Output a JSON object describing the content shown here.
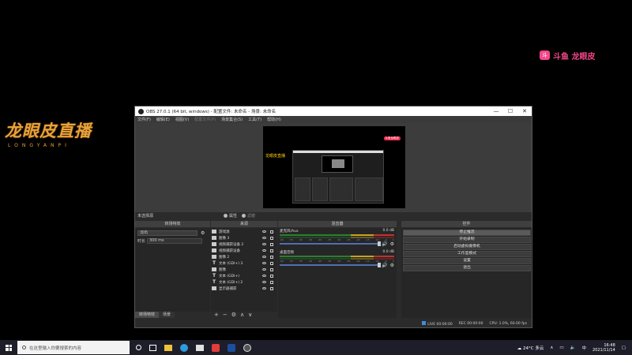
{
  "overlay": {
    "brand_cn": "龙眼皮直播",
    "brand_en": "LONGYANPI",
    "douyu_logo": "斗",
    "douyu_text": "斗鱼 龙眼皮"
  },
  "window": {
    "title": "OBS 27.0.1 (64 bit, windows) - 配置文件: 未命名 - 场景: 未命名",
    "controls": [
      "—",
      "☐",
      "✕"
    ]
  },
  "menu": {
    "items": [
      "文件(F)",
      "编辑(E)",
      "视图(V)",
      "配置文件(P)",
      "场景集合(S)",
      "工具(T)",
      "帮助(H)"
    ],
    "disabled_index": 3
  },
  "preview": {
    "overlay_text": "龙眼皮直播",
    "badge": "斗鱼龙眼皮"
  },
  "scene_bar": {
    "selection": "未选择源",
    "properties": "属性",
    "filters": "滤镜"
  },
  "docks": {
    "transitions": "转场特效",
    "sources": "来源",
    "mixer": "混音器",
    "controls": "控件"
  },
  "transitions": {
    "selected": "淡出",
    "duration_label": "时长",
    "duration_value": "300 ms"
  },
  "bottom_tabs": [
    "转场特效",
    "场景"
  ],
  "sources": [
    {
      "name": "游戏源",
      "icon": "game-icon"
    },
    {
      "name": "图像 3",
      "icon": "image-icon"
    },
    {
      "name": "视频捕获设备 2",
      "icon": "camera-icon"
    },
    {
      "name": "视频捕获设备",
      "icon": "camera-icon"
    },
    {
      "name": "图像 2",
      "icon": "image-icon"
    },
    {
      "name": "文本 (GDI+) 3",
      "icon": "text-icon"
    },
    {
      "name": "图像",
      "icon": "image-icon"
    },
    {
      "name": "文本 (GDI+)",
      "icon": "text-icon"
    },
    {
      "name": "文本 (GDI+) 2",
      "icon": "text-icon"
    },
    {
      "name": "显示器捕获",
      "icon": "monitor-icon"
    }
  ],
  "source_toolbar": [
    "+",
    "−",
    "⚙",
    "∧",
    "∨"
  ],
  "mixer": {
    "channels": [
      {
        "name": "麦克风/Aux",
        "db": "0.0 dB"
      },
      {
        "name": "桌面音频",
        "db": "0.0 dB"
      }
    ],
    "ticks": [
      "-60",
      "-55",
      "-50",
      "-45",
      "-40",
      "-35",
      "-30",
      "-25",
      "-20",
      "-15",
      "-10",
      "-5",
      "0"
    ]
  },
  "controls": {
    "buttons": [
      "停止推流",
      "开始录制",
      "启动虚拟摄像机",
      "工作室模式",
      "设置",
      "退出"
    ],
    "active_index": 0
  },
  "status": {
    "live_label": "LIVE",
    "live_time": "00:00:00",
    "rec_label": "REC",
    "rec_time": "00:00:00",
    "cpu": "CPU: 1.0%, 60.00 fps"
  },
  "taskbar": {
    "search_placeholder": "在这里输入你要搜索的内容",
    "weather": "24°C 多云",
    "time": "16:48",
    "date": "2021/11/14"
  }
}
